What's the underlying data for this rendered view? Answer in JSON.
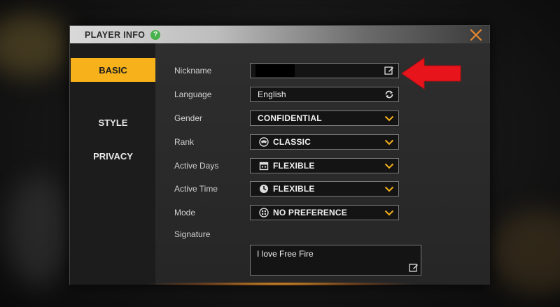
{
  "dialog": {
    "title": "PLAYER INFO",
    "help_glyph": "?",
    "close_icon": "close-x-icon"
  },
  "tabs": [
    {
      "label": "BASIC",
      "active": true
    },
    {
      "label": "STYLE",
      "active": false
    },
    {
      "label": "PRIVACY",
      "active": false
    }
  ],
  "fields": {
    "nickname": {
      "label": "Nickname",
      "value": "",
      "icon": "edit-icon"
    },
    "language": {
      "label": "Language",
      "value": "English",
      "icon": "refresh-icon"
    },
    "gender": {
      "label": "Gender",
      "value": "CONFIDENTIAL",
      "icon": "chevron-down-icon"
    },
    "rank": {
      "label": "Rank",
      "value": "CLASSIC",
      "lead_icon": "classic-mode-icon",
      "icon": "chevron-down-icon"
    },
    "active_days": {
      "label": "Active Days",
      "value": "FLEXIBLE",
      "lead_icon": "calendar-icon",
      "icon": "chevron-down-icon"
    },
    "active_time": {
      "label": "Active Time",
      "value": "FLEXIBLE",
      "lead_icon": "clock-icon",
      "icon": "chevron-down-icon"
    },
    "mode": {
      "label": "Mode",
      "value": "NO PREFERENCE",
      "lead_icon": "gamepad-icon",
      "icon": "chevron-down-icon"
    },
    "signature": {
      "label": "Signature",
      "value": "I love Free Fire",
      "icon": "edit-icon"
    }
  },
  "colors": {
    "accent": "#f7b21b",
    "close": "#e8892c",
    "help": "#47b24a",
    "annotation_arrow": "#e8141c"
  }
}
